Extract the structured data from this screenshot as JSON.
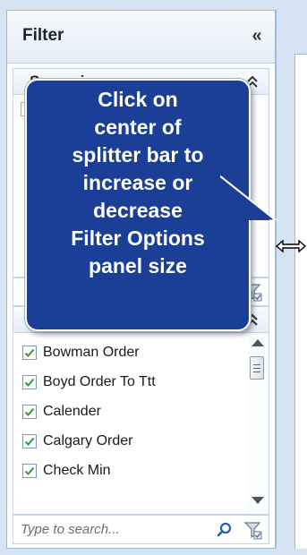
{
  "panel": {
    "title": "Filter",
    "collapse_glyph": "«"
  },
  "section1": {
    "title": "Scenarios",
    "toggle_glyph": "⌃"
  },
  "section2": {
    "toggle_glyph": "⌃"
  },
  "list": {
    "items": [
      {
        "label": "Bowman Order",
        "checked": true
      },
      {
        "label": "Boyd Order To Ttt",
        "checked": true
      },
      {
        "label": "Calender",
        "checked": true
      },
      {
        "label": "Calgary Order",
        "checked": true
      },
      {
        "label": "Check Min",
        "checked": true
      }
    ]
  },
  "search": {
    "placeholder": "Type to search..."
  },
  "tooltip": {
    "text": "Click on\ncenter of\nsplitter bar to\nincrease or\ndecrease\nFilter Options\npanel size"
  },
  "icons": {
    "collapse": "double-chevron-left-icon",
    "section_toggle": "double-chevron-up-icon",
    "filter": "funnel-icon",
    "search": "magnifier-icon",
    "cursor": "resize-horizontal-cursor-icon",
    "check": "checkmark-icon"
  },
  "colors": {
    "tooltip_bg": "#1b3f97",
    "panel_border": "#9fb9d8",
    "check_green": "#2f9c3a",
    "window_bg": "#d5e3f2"
  }
}
